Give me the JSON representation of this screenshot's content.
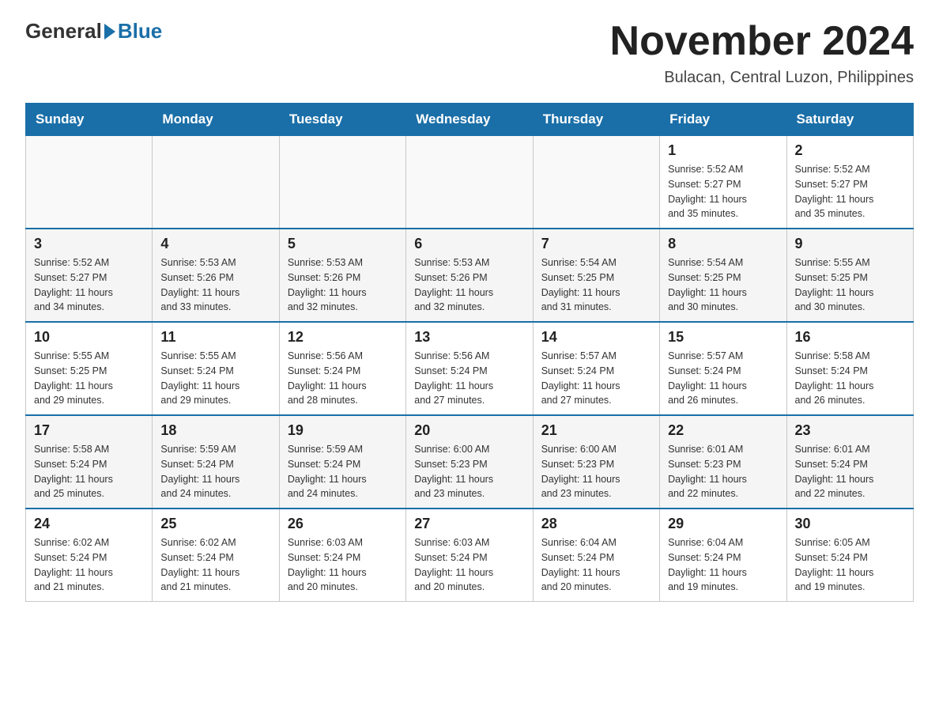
{
  "header": {
    "logo": {
      "general": "General",
      "blue": "Blue"
    },
    "title": "November 2024",
    "subtitle": "Bulacan, Central Luzon, Philippines"
  },
  "calendar": {
    "days_of_week": [
      "Sunday",
      "Monday",
      "Tuesday",
      "Wednesday",
      "Thursday",
      "Friday",
      "Saturday"
    ],
    "weeks": [
      {
        "days": [
          {
            "number": "",
            "info": ""
          },
          {
            "number": "",
            "info": ""
          },
          {
            "number": "",
            "info": ""
          },
          {
            "number": "",
            "info": ""
          },
          {
            "number": "",
            "info": ""
          },
          {
            "number": "1",
            "info": "Sunrise: 5:52 AM\nSunset: 5:27 PM\nDaylight: 11 hours\nand 35 minutes."
          },
          {
            "number": "2",
            "info": "Sunrise: 5:52 AM\nSunset: 5:27 PM\nDaylight: 11 hours\nand 35 minutes."
          }
        ]
      },
      {
        "days": [
          {
            "number": "3",
            "info": "Sunrise: 5:52 AM\nSunset: 5:27 PM\nDaylight: 11 hours\nand 34 minutes."
          },
          {
            "number": "4",
            "info": "Sunrise: 5:53 AM\nSunset: 5:26 PM\nDaylight: 11 hours\nand 33 minutes."
          },
          {
            "number": "5",
            "info": "Sunrise: 5:53 AM\nSunset: 5:26 PM\nDaylight: 11 hours\nand 32 minutes."
          },
          {
            "number": "6",
            "info": "Sunrise: 5:53 AM\nSunset: 5:26 PM\nDaylight: 11 hours\nand 32 minutes."
          },
          {
            "number": "7",
            "info": "Sunrise: 5:54 AM\nSunset: 5:25 PM\nDaylight: 11 hours\nand 31 minutes."
          },
          {
            "number": "8",
            "info": "Sunrise: 5:54 AM\nSunset: 5:25 PM\nDaylight: 11 hours\nand 30 minutes."
          },
          {
            "number": "9",
            "info": "Sunrise: 5:55 AM\nSunset: 5:25 PM\nDaylight: 11 hours\nand 30 minutes."
          }
        ]
      },
      {
        "days": [
          {
            "number": "10",
            "info": "Sunrise: 5:55 AM\nSunset: 5:25 PM\nDaylight: 11 hours\nand 29 minutes."
          },
          {
            "number": "11",
            "info": "Sunrise: 5:55 AM\nSunset: 5:24 PM\nDaylight: 11 hours\nand 29 minutes."
          },
          {
            "number": "12",
            "info": "Sunrise: 5:56 AM\nSunset: 5:24 PM\nDaylight: 11 hours\nand 28 minutes."
          },
          {
            "number": "13",
            "info": "Sunrise: 5:56 AM\nSunset: 5:24 PM\nDaylight: 11 hours\nand 27 minutes."
          },
          {
            "number": "14",
            "info": "Sunrise: 5:57 AM\nSunset: 5:24 PM\nDaylight: 11 hours\nand 27 minutes."
          },
          {
            "number": "15",
            "info": "Sunrise: 5:57 AM\nSunset: 5:24 PM\nDaylight: 11 hours\nand 26 minutes."
          },
          {
            "number": "16",
            "info": "Sunrise: 5:58 AM\nSunset: 5:24 PM\nDaylight: 11 hours\nand 26 minutes."
          }
        ]
      },
      {
        "days": [
          {
            "number": "17",
            "info": "Sunrise: 5:58 AM\nSunset: 5:24 PM\nDaylight: 11 hours\nand 25 minutes."
          },
          {
            "number": "18",
            "info": "Sunrise: 5:59 AM\nSunset: 5:24 PM\nDaylight: 11 hours\nand 24 minutes."
          },
          {
            "number": "19",
            "info": "Sunrise: 5:59 AM\nSunset: 5:24 PM\nDaylight: 11 hours\nand 24 minutes."
          },
          {
            "number": "20",
            "info": "Sunrise: 6:00 AM\nSunset: 5:23 PM\nDaylight: 11 hours\nand 23 minutes."
          },
          {
            "number": "21",
            "info": "Sunrise: 6:00 AM\nSunset: 5:23 PM\nDaylight: 11 hours\nand 23 minutes."
          },
          {
            "number": "22",
            "info": "Sunrise: 6:01 AM\nSunset: 5:23 PM\nDaylight: 11 hours\nand 22 minutes."
          },
          {
            "number": "23",
            "info": "Sunrise: 6:01 AM\nSunset: 5:24 PM\nDaylight: 11 hours\nand 22 minutes."
          }
        ]
      },
      {
        "days": [
          {
            "number": "24",
            "info": "Sunrise: 6:02 AM\nSunset: 5:24 PM\nDaylight: 11 hours\nand 21 minutes."
          },
          {
            "number": "25",
            "info": "Sunrise: 6:02 AM\nSunset: 5:24 PM\nDaylight: 11 hours\nand 21 minutes."
          },
          {
            "number": "26",
            "info": "Sunrise: 6:03 AM\nSunset: 5:24 PM\nDaylight: 11 hours\nand 20 minutes."
          },
          {
            "number": "27",
            "info": "Sunrise: 6:03 AM\nSunset: 5:24 PM\nDaylight: 11 hours\nand 20 minutes."
          },
          {
            "number": "28",
            "info": "Sunrise: 6:04 AM\nSunset: 5:24 PM\nDaylight: 11 hours\nand 20 minutes."
          },
          {
            "number": "29",
            "info": "Sunrise: 6:04 AM\nSunset: 5:24 PM\nDaylight: 11 hours\nand 19 minutes."
          },
          {
            "number": "30",
            "info": "Sunrise: 6:05 AM\nSunset: 5:24 PM\nDaylight: 11 hours\nand 19 minutes."
          }
        ]
      }
    ]
  }
}
